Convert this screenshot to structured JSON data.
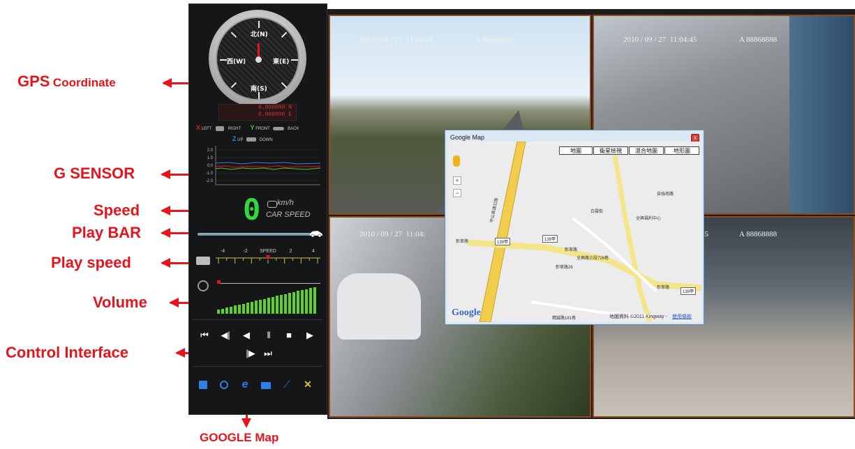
{
  "annotations": {
    "gps_main": "GPS",
    "gps_sub": "Coordinate",
    "g_sensor": "G SENSOR",
    "speed": "Speed",
    "play_bar": "Play BAR",
    "play_speed": "Play speed",
    "volume": "Volume",
    "control_interface": "Control Interface",
    "google_map": "GOOGLE Map",
    "color": "#e8141c"
  },
  "compass": {
    "north": "北(N)",
    "south": "南(S)",
    "east": "東(E)",
    "west": "西(W)"
  },
  "gps": {
    "line1": "0.000000 N",
    "line2": "0.000000 E"
  },
  "gsensor_legend": {
    "x_axis": "X",
    "x_neg": "LEFT",
    "x_pos": "RIGHT",
    "y_axis": "Y",
    "y_pos": "FRONT",
    "y_neg": "BACK",
    "z_axis": "Z",
    "z_pos": "UP",
    "z_neg": "DOWN",
    "y_ticks": [
      "2.0",
      "1.0",
      "0.0",
      "-1.0",
      "-2.0"
    ]
  },
  "speed": {
    "value": "0",
    "unit": "km/h",
    "caption": "CAR SPEED",
    "digit_color": "#34d63d"
  },
  "playbar": {
    "progress": 1.0
  },
  "play_speed": {
    "label": "SPEED",
    "ticks": [
      "-4",
      "-2",
      "SPEED",
      "2",
      "4"
    ],
    "current": 0
  },
  "volume": {
    "level": 1.0
  },
  "controls": {
    "row1": [
      "⏮",
      "◀|",
      "◀",
      "‖",
      "■",
      "▶"
    ],
    "row2": [
      "|▶",
      "⏭"
    ],
    "tools": [
      "save-icon",
      "settings-icon",
      "browser-icon",
      "folder-icon",
      "wrench-icon",
      "tools-icon"
    ]
  },
  "videos": [
    {
      "datetime": "2010 / 09 / 27  11:04:45",
      "plate": "A 88868888"
    },
    {
      "datetime": "2010 / 09 / 27  11:04:45",
      "plate": "A 88868888"
    },
    {
      "datetime": "2010 / 09 / 27  11:04:",
      "plate": ""
    },
    {
      "datetime": ":45",
      "plate": "A 88868888"
    }
  ],
  "google_map": {
    "title": "Google Map",
    "close": "x",
    "map_types": [
      "地圖",
      "衛星檢視",
      "混合地圖",
      "地形圖"
    ],
    "road_labels": [
      "中山高速公路",
      "彰草路",
      "139甲",
      "139甲",
      "彰草路",
      "全興路三段726巷",
      "彰草路26",
      "全興福利中心",
      "白雲街",
      "自強南路",
      "139甲",
      "彰草路",
      "精誠路181巷"
    ],
    "copyright": "地圖資料 ©2011 Kingway -",
    "terms_link": "使用條款",
    "logo": "Google"
  }
}
